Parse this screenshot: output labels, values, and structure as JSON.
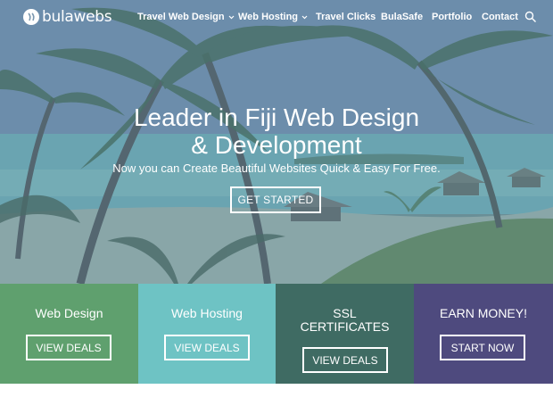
{
  "brand": {
    "name": "bulawebs"
  },
  "nav": {
    "items": [
      {
        "label": "Travel Web Design",
        "has_dropdown": true
      },
      {
        "label": "Web Hosting",
        "has_dropdown": true
      },
      {
        "label": "Travel Clicks",
        "has_dropdown": false
      },
      {
        "label": "BulaSafe",
        "has_dropdown": false
      },
      {
        "label": "Portfolio",
        "has_dropdown": false
      },
      {
        "label": "Contact",
        "has_dropdown": false
      }
    ],
    "search_icon": "search-icon"
  },
  "hero": {
    "title_line1": "Leader in Fiji Web Design",
    "title_line2": "& Development",
    "subtitle": "Now you can Create Beautiful Websites Quick & Easy For Free.",
    "cta_label": "GET STARTED"
  },
  "cards": [
    {
      "title": "Web Design",
      "button": "VIEW DEALS",
      "color": "#5fa06e"
    },
    {
      "title": "Web Hosting",
      "button": "VIEW DEALS",
      "color": "#6ec3c4"
    },
    {
      "title_line1": "SSL",
      "title_line2": "CERTIFICATES",
      "button": "VIEW DEALS",
      "color": "#3f6b63"
    },
    {
      "title": "EARN MONEY!",
      "button": "START NOW",
      "color": "#4e4a7e"
    }
  ]
}
